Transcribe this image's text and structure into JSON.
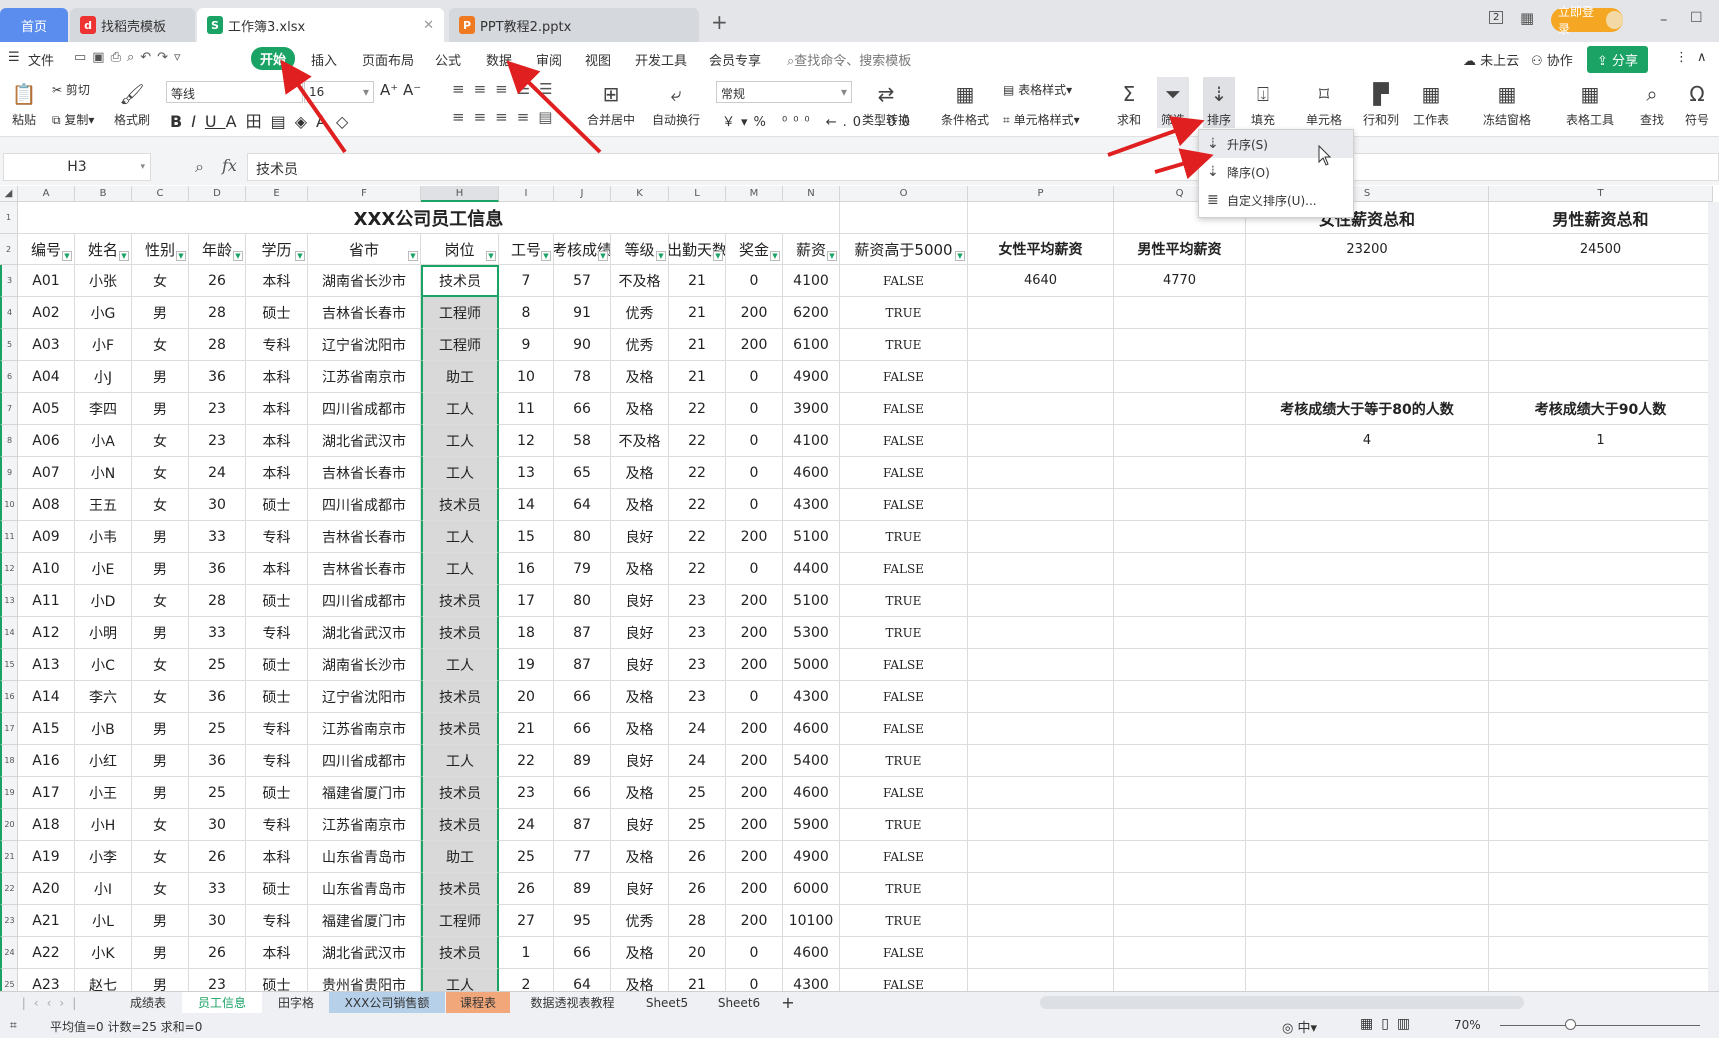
{
  "tabs": [
    {
      "label": "首页"
    },
    {
      "label": "找稻壳模板"
    },
    {
      "label": "工作簿3.xlsx"
    },
    {
      "label": "PPT教程2.pptx"
    }
  ],
  "titlebar": {
    "login": "立即登录",
    "page_badge": "2"
  },
  "menu": {
    "file": "文件",
    "items": [
      "开始",
      "插入",
      "页面布局",
      "公式",
      "数据",
      "审阅",
      "视图",
      "开发工具",
      "会员专享"
    ],
    "search_placeholder": "查找命令、搜索模板",
    "cloud": "未上云",
    "collab": "协作",
    "share": "分享"
  },
  "ribbon": {
    "paste": "粘贴",
    "cut": "剪切",
    "copy": "复制",
    "format_painter": "格式刷",
    "font": "等线",
    "font_size": "16",
    "merge": "合并居中",
    "wrap": "自动换行",
    "number_format": "常规",
    "convert": "类型转换",
    "cond_format": "条件格式",
    "table_style": "表格样式",
    "cell_style": "单元格样式",
    "sum": "求和",
    "filter": "筛选",
    "sort": "排序",
    "fill": "填充",
    "cell": "单元格",
    "rowcol": "行和列",
    "sheet": "工作表",
    "freeze": "冻结窗格",
    "tools": "表格工具",
    "find": "查找",
    "symbol": "符号"
  },
  "sort_menu": [
    {
      "label": "升序(S)",
      "icon": "sort-ascending-icon"
    },
    {
      "label": "降序(O)",
      "icon": "sort-descending-icon"
    },
    {
      "label": "自定义排序(U)...",
      "icon": "custom-sort-icon"
    }
  ],
  "formula_bar": {
    "cell_ref": "H3",
    "fx": "fx",
    "value": "技术员"
  },
  "sheet": {
    "columns": [
      "A",
      "B",
      "C",
      "D",
      "E",
      "F",
      "H",
      "I",
      "J",
      "K",
      "L",
      "M",
      "N",
      "O",
      "P",
      "Q",
      "S",
      "T"
    ],
    "title": "XXX公司员工信息",
    "headers": [
      "编号",
      "姓名",
      "性别",
      "年龄",
      "学历",
      "省市",
      "岗位",
      "工号",
      "考核成绩",
      "等级",
      "出勤天数",
      "奖金",
      "薪资",
      "薪资高于5000"
    ],
    "rows": [
      [
        "A01",
        "小张",
        "女",
        "26",
        "本科",
        "湖南省长沙市",
        "技术员",
        "7",
        "57",
        "不及格",
        "21",
        "0",
        "4100",
        "FALSE"
      ],
      [
        "A02",
        "小G",
        "男",
        "28",
        "硕士",
        "吉林省长春市",
        "工程师",
        "8",
        "91",
        "优秀",
        "21",
        "200",
        "6200",
        "TRUE"
      ],
      [
        "A03",
        "小F",
        "女",
        "28",
        "专科",
        "辽宁省沈阳市",
        "工程师",
        "9",
        "90",
        "优秀",
        "21",
        "200",
        "6100",
        "TRUE"
      ],
      [
        "A04",
        "小J",
        "男",
        "36",
        "本科",
        "江苏省南京市",
        "助工",
        "10",
        "78",
        "及格",
        "21",
        "0",
        "4900",
        "FALSE"
      ],
      [
        "A05",
        "李四",
        "男",
        "23",
        "本科",
        "四川省成都市",
        "工人",
        "11",
        "66",
        "及格",
        "22",
        "0",
        "3900",
        "FALSE"
      ],
      [
        "A06",
        "小A",
        "女",
        "23",
        "本科",
        "湖北省武汉市",
        "工人",
        "12",
        "58",
        "不及格",
        "22",
        "0",
        "4100",
        "FALSE"
      ],
      [
        "A07",
        "小N",
        "女",
        "24",
        "本科",
        "吉林省长春市",
        "工人",
        "13",
        "65",
        "及格",
        "22",
        "0",
        "4600",
        "FALSE"
      ],
      [
        "A08",
        "王五",
        "女",
        "30",
        "硕士",
        "四川省成都市",
        "技术员",
        "14",
        "64",
        "及格",
        "22",
        "0",
        "4300",
        "FALSE"
      ],
      [
        "A09",
        "小韦",
        "男",
        "33",
        "专科",
        "吉林省长春市",
        "工人",
        "15",
        "80",
        "良好",
        "22",
        "200",
        "5100",
        "TRUE"
      ],
      [
        "A10",
        "小E",
        "男",
        "36",
        "本科",
        "吉林省长春市",
        "工人",
        "16",
        "79",
        "及格",
        "22",
        "0",
        "4400",
        "FALSE"
      ],
      [
        "A11",
        "小D",
        "女",
        "28",
        "硕士",
        "四川省成都市",
        "技术员",
        "17",
        "80",
        "良好",
        "23",
        "200",
        "5100",
        "TRUE"
      ],
      [
        "A12",
        "小明",
        "男",
        "33",
        "专科",
        "湖北省武汉市",
        "技术员",
        "18",
        "87",
        "良好",
        "23",
        "200",
        "5300",
        "TRUE"
      ],
      [
        "A13",
        "小C",
        "女",
        "25",
        "硕士",
        "湖南省长沙市",
        "工人",
        "19",
        "87",
        "良好",
        "23",
        "200",
        "5000",
        "FALSE"
      ],
      [
        "A14",
        "李六",
        "女",
        "36",
        "硕士",
        "辽宁省沈阳市",
        "技术员",
        "20",
        "66",
        "及格",
        "23",
        "0",
        "4300",
        "FALSE"
      ],
      [
        "A15",
        "小B",
        "男",
        "25",
        "专科",
        "江苏省南京市",
        "技术员",
        "21",
        "66",
        "及格",
        "24",
        "200",
        "4600",
        "FALSE"
      ],
      [
        "A16",
        "小红",
        "男",
        "36",
        "专科",
        "四川省成都市",
        "工人",
        "22",
        "89",
        "良好",
        "24",
        "200",
        "5400",
        "TRUE"
      ],
      [
        "A17",
        "小王",
        "男",
        "25",
        "硕士",
        "福建省厦门市",
        "技术员",
        "23",
        "66",
        "及格",
        "25",
        "200",
        "4600",
        "FALSE"
      ],
      [
        "A18",
        "小H",
        "女",
        "30",
        "专科",
        "江苏省南京市",
        "技术员",
        "24",
        "87",
        "良好",
        "25",
        "200",
        "5900",
        "TRUE"
      ],
      [
        "A19",
        "小李",
        "女",
        "26",
        "本科",
        "山东省青岛市",
        "助工",
        "25",
        "77",
        "及格",
        "26",
        "200",
        "4900",
        "FALSE"
      ],
      [
        "A20",
        "小I",
        "女",
        "33",
        "硕士",
        "山东省青岛市",
        "技术员",
        "26",
        "89",
        "良好",
        "26",
        "200",
        "6000",
        "TRUE"
      ],
      [
        "A21",
        "小L",
        "男",
        "30",
        "专科",
        "福建省厦门市",
        "工程师",
        "27",
        "95",
        "优秀",
        "28",
        "200",
        "10100",
        "TRUE"
      ],
      [
        "A22",
        "小K",
        "男",
        "26",
        "本科",
        "湖北省武汉市",
        "技术员",
        "1",
        "66",
        "及格",
        "20",
        "0",
        "4600",
        "FALSE"
      ],
      [
        "A23",
        "赵七",
        "男",
        "23",
        "硕士",
        "贵州省贵阳市",
        "工人",
        "2",
        "64",
        "及格",
        "21",
        "0",
        "4300",
        "FALSE"
      ]
    ],
    "extra": {
      "female_avg_label": "女性平均薪资",
      "male_avg_label": "男性平均薪资",
      "female_avg": "4640",
      "male_avg": "4770",
      "female_total_label": "女性薪资总和",
      "male_total_label": "男性薪资总和",
      "female_total": "23200",
      "male_total": "24500",
      "ge80_label": "考核成绩大于等于80的人数",
      "gt90_label": "考核成绩大于90人数",
      "ge80": "4",
      "gt90": "1"
    }
  },
  "sheet_tabs": [
    "成绩表",
    "员工信息",
    "田字格",
    "XXX公司销售额",
    "课程表",
    "数据透视表教程",
    "Sheet5",
    "Sheet6"
  ],
  "status": {
    "summary": "平均值=0  计数=25  求和=0",
    "zoom": "70%"
  },
  "colors": {
    "accent": "#1aa364",
    "tab_home": "#5b8def",
    "login": "#f5a623",
    "arrow": "#e02020"
  }
}
